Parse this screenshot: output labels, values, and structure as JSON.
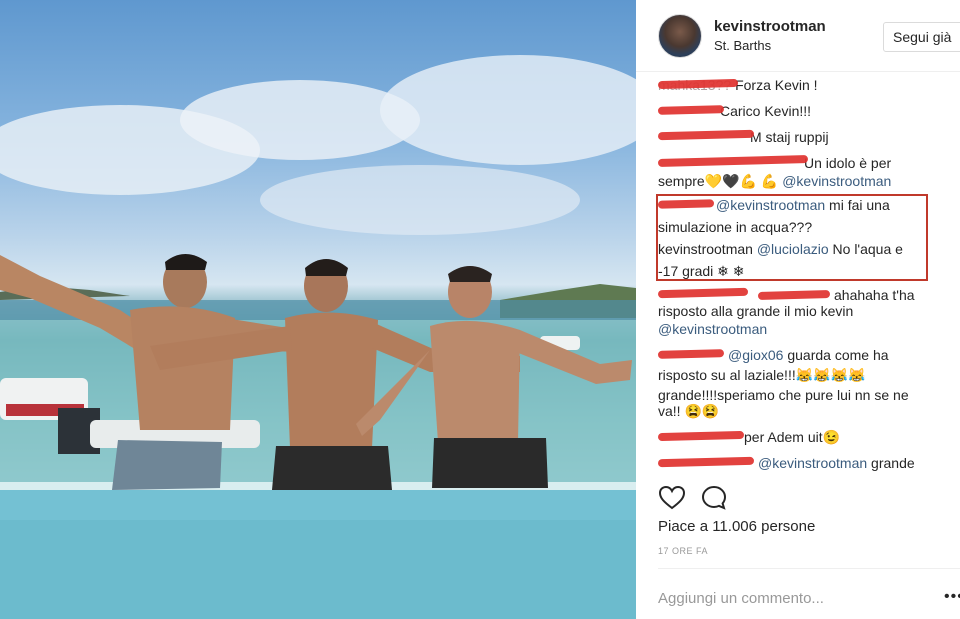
{
  "post": {
    "username": "kevinstrootman",
    "location": "St. Barths",
    "follow_label": "Segui già",
    "likes": "Piace a 11.006 persone",
    "timestamp": "17 ORE FA",
    "comment_placeholder": "Aggiungi un commento...",
    "more_label": "•••"
  },
  "comments": [
    {
      "user": "",
      "text": "Forza Kevin !"
    },
    {
      "user": "",
      "text": "Carico Kevin!!!"
    },
    {
      "user": "",
      "text": "M staij ruppij"
    },
    {
      "user": "",
      "text": "Un idolo è per"
    },
    {
      "user": "",
      "text": "sempre💛🖤💪 💪",
      "mention": "@kevinstrootman"
    },
    {
      "user": "",
      "mention": "@kevinstrootman",
      "text": "mi fai una"
    },
    {
      "user": "",
      "text": "simulazione in acqua???"
    },
    {
      "user": "kevinstrootman",
      "mention": "@luciolazio",
      "text": "No l'aqua e"
    },
    {
      "user": "",
      "text": "-17 gradi ❄ ❄"
    },
    {
      "user": "",
      "text": "ahahaha t'ha"
    },
    {
      "user": "",
      "text": "risposto alla grande il mio kevin"
    },
    {
      "user": "",
      "mention": "@kevinstrootman"
    },
    {
      "user": "",
      "mention": "@giox06",
      "text": "guarda come ha"
    },
    {
      "user": "",
      "text": "risposto su al laziale!!!😹😹😹😹"
    },
    {
      "user": "",
      "text": "grande!!!!speriamo che pure lui nn se ne"
    },
    {
      "user": "",
      "text": "va!! 😫😫"
    },
    {
      "user": "",
      "text": "per Adem uit😉"
    },
    {
      "user": "",
      "mention": "@kevinstrootman",
      "text": "grande"
    }
  ],
  "icons": {
    "like": "heart-icon",
    "comment": "comment-icon"
  },
  "colors": {
    "highlight": "#c0392b",
    "scribble": "#e0322f",
    "mention": "#3b5c7e"
  }
}
